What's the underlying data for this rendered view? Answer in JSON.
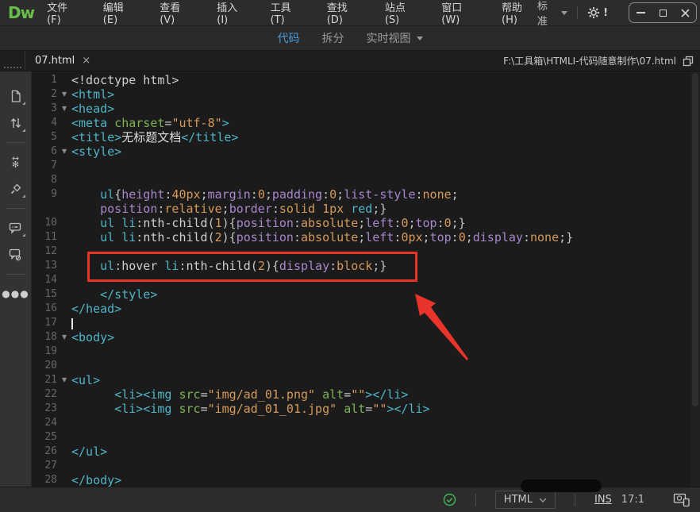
{
  "colors": {
    "bg-editor": "#1b1b1b",
    "bg-bar": "#2c2c2c",
    "bg-side": "#333333",
    "tag": "#4fb5c7",
    "attr": "#7eb456",
    "val": "#d59a5b",
    "prop": "#a887cd",
    "pun": "#c4c4c4",
    "pln": "#cfcfcf",
    "txt": "#dcdcdc",
    "accent": "#4a9bd9",
    "annot": "#e8342a",
    "logo": "#6abf4b",
    "check": "#3fb950"
  },
  "titlebar": {
    "logo": "Dw",
    "menus": [
      {
        "id": "file",
        "label": "文件(F)"
      },
      {
        "id": "edit",
        "label": "编辑(E)"
      },
      {
        "id": "view",
        "label": "查看(V)"
      },
      {
        "id": "insert",
        "label": "插入(I)"
      },
      {
        "id": "tools",
        "label": "工具(T)"
      },
      {
        "id": "find",
        "label": "查找(D)"
      },
      {
        "id": "site",
        "label": "站点(S)"
      },
      {
        "id": "window",
        "label": "窗口(W)"
      },
      {
        "id": "help",
        "label": "帮助(H)"
      }
    ],
    "workspace": "标准",
    "notification": "!"
  },
  "viewbar": {
    "tabs": [
      {
        "id": "code",
        "label": "代码",
        "active": true,
        "dropdown": false
      },
      {
        "id": "split",
        "label": "拆分",
        "active": false,
        "dropdown": false
      },
      {
        "id": "live",
        "label": "实时视图",
        "active": false,
        "dropdown": true
      }
    ]
  },
  "tabbar": {
    "tab": "07.html",
    "close": "×",
    "path": "F:\\工具箱\\HTMLI-代码随意制作\\07.html"
  },
  "sidebar": {
    "icons": [
      "new-file",
      "move-lines",
      "toggle-word-wrap",
      "format-source-code",
      "apply-comment",
      "remove-comment",
      "more-options"
    ]
  },
  "statusbar": {
    "doctype": "HTML",
    "ins": "INS",
    "cursor_position": "17:1"
  },
  "editor": {
    "lines": [
      {
        "n": "1",
        "fold": false,
        "tokens": [
          [
            "pln",
            "<!doctype html>"
          ]
        ]
      },
      {
        "n": "2",
        "fold": true,
        "tokens": [
          [
            "tag",
            "<html>"
          ]
        ]
      },
      {
        "n": "3",
        "fold": true,
        "tokens": [
          [
            "tag",
            "<head>"
          ]
        ]
      },
      {
        "n": "4",
        "fold": false,
        "tokens": [
          [
            "tag",
            "<meta"
          ],
          [
            "pln",
            " "
          ],
          [
            "attr",
            "charset"
          ],
          [
            "pun",
            "="
          ],
          [
            "val",
            "\"utf-8\""
          ],
          [
            "tag",
            ">"
          ]
        ]
      },
      {
        "n": "5",
        "fold": false,
        "tokens": [
          [
            "tag",
            "<title>"
          ],
          [
            "txt",
            "无标题文档"
          ],
          [
            "tag",
            "</title>"
          ]
        ]
      },
      {
        "n": "6",
        "fold": true,
        "tokens": [
          [
            "tag",
            "<style>"
          ]
        ]
      },
      {
        "n": "7",
        "fold": false,
        "tokens": []
      },
      {
        "n": "8",
        "fold": false,
        "tokens": []
      },
      {
        "n": "9",
        "fold": false,
        "tokens": [
          [
            "pln",
            "    "
          ],
          [
            "tag",
            "ul"
          ],
          [
            "pun",
            "{"
          ],
          [
            "prop",
            "height"
          ],
          [
            "pun",
            ":"
          ],
          [
            "val",
            "40px"
          ],
          [
            "pun",
            ";"
          ],
          [
            "prop",
            "margin"
          ],
          [
            "pun",
            ":"
          ],
          [
            "val",
            "0"
          ],
          [
            "pun",
            ";"
          ],
          [
            "prop",
            "padding"
          ],
          [
            "pun",
            ":"
          ],
          [
            "val",
            "0"
          ],
          [
            "pun",
            ";"
          ],
          [
            "prop",
            "list-style"
          ],
          [
            "pun",
            ":"
          ],
          [
            "val",
            "none"
          ],
          [
            "pun",
            ";"
          ]
        ]
      },
      {
        "n": "",
        "fold": false,
        "tokens": [
          [
            "pln",
            "    "
          ],
          [
            "prop",
            "position"
          ],
          [
            "pun",
            ":"
          ],
          [
            "val",
            "relative"
          ],
          [
            "pun",
            ";"
          ],
          [
            "prop",
            "border"
          ],
          [
            "pun",
            ":"
          ],
          [
            "val",
            "solid 1px "
          ],
          [
            "tag",
            "red"
          ],
          [
            "pun",
            ";}"
          ]
        ]
      },
      {
        "n": "10",
        "fold": false,
        "tokens": [
          [
            "pln",
            "    "
          ],
          [
            "tag",
            "ul li"
          ],
          [
            "pun",
            ":"
          ],
          [
            "pln",
            "nth-child"
          ],
          [
            "pun",
            "("
          ],
          [
            "val",
            "1"
          ],
          [
            "pun",
            "){"
          ],
          [
            "prop",
            "position"
          ],
          [
            "pun",
            ":"
          ],
          [
            "val",
            "absolute"
          ],
          [
            "pun",
            ";"
          ],
          [
            "prop",
            "left"
          ],
          [
            "pun",
            ":"
          ],
          [
            "val",
            "0"
          ],
          [
            "pun",
            ";"
          ],
          [
            "prop",
            "top"
          ],
          [
            "pun",
            ":"
          ],
          [
            "val",
            "0"
          ],
          [
            "pun",
            ";}"
          ]
        ]
      },
      {
        "n": "11",
        "fold": false,
        "tokens": [
          [
            "pln",
            "    "
          ],
          [
            "tag",
            "ul li"
          ],
          [
            "pun",
            ":"
          ],
          [
            "pln",
            "nth-child"
          ],
          [
            "pun",
            "("
          ],
          [
            "val",
            "2"
          ],
          [
            "pun",
            "){"
          ],
          [
            "prop",
            "position"
          ],
          [
            "pun",
            ":"
          ],
          [
            "val",
            "absolute"
          ],
          [
            "pun",
            ";"
          ],
          [
            "prop",
            "left"
          ],
          [
            "pun",
            ":"
          ],
          [
            "val",
            "0px"
          ],
          [
            "pun",
            ";"
          ],
          [
            "prop",
            "top"
          ],
          [
            "pun",
            ":"
          ],
          [
            "val",
            "0"
          ],
          [
            "pun",
            ";"
          ],
          [
            "prop",
            "display"
          ],
          [
            "pun",
            ":"
          ],
          [
            "val",
            "none"
          ],
          [
            "pun",
            ";}"
          ]
        ]
      },
      {
        "n": "12",
        "fold": false,
        "tokens": []
      },
      {
        "n": "13",
        "fold": false,
        "tokens": [
          [
            "pln",
            "    "
          ],
          [
            "tag",
            "ul"
          ],
          [
            "pun",
            ":"
          ],
          [
            "pln",
            "hover "
          ],
          [
            "tag",
            "li"
          ],
          [
            "pun",
            ":"
          ],
          [
            "pln",
            "nth-child"
          ],
          [
            "pun",
            "("
          ],
          [
            "val",
            "2"
          ],
          [
            "pun",
            "){"
          ],
          [
            "prop",
            "display"
          ],
          [
            "pun",
            ":"
          ],
          [
            "val",
            "block"
          ],
          [
            "pun",
            ";}"
          ]
        ]
      },
      {
        "n": "14",
        "fold": false,
        "tokens": []
      },
      {
        "n": "15",
        "fold": false,
        "tokens": [
          [
            "pln",
            "    "
          ],
          [
            "tag",
            "</style>"
          ]
        ]
      },
      {
        "n": "16",
        "fold": false,
        "tokens": [
          [
            "tag",
            "</head>"
          ]
        ]
      },
      {
        "n": "17",
        "fold": false,
        "tokens": [
          [
            "caret",
            ""
          ]
        ]
      },
      {
        "n": "18",
        "fold": true,
        "tokens": [
          [
            "tag",
            "<body>"
          ]
        ]
      },
      {
        "n": "19",
        "fold": false,
        "tokens": []
      },
      {
        "n": "20",
        "fold": false,
        "tokens": []
      },
      {
        "n": "21",
        "fold": true,
        "tokens": [
          [
            "tag",
            "<ul>"
          ]
        ]
      },
      {
        "n": "22",
        "fold": false,
        "tokens": [
          [
            "pln",
            "      "
          ],
          [
            "tag",
            "<li><img"
          ],
          [
            "pln",
            " "
          ],
          [
            "attr",
            "src"
          ],
          [
            "pun",
            "="
          ],
          [
            "val",
            "\"img/ad_01.png\""
          ],
          [
            "pln",
            " "
          ],
          [
            "attr",
            "alt"
          ],
          [
            "pun",
            "="
          ],
          [
            "val",
            "\"\""
          ],
          [
            "tag",
            "></li>"
          ]
        ]
      },
      {
        "n": "23",
        "fold": false,
        "tokens": [
          [
            "pln",
            "      "
          ],
          [
            "tag",
            "<li><img"
          ],
          [
            "pln",
            " "
          ],
          [
            "attr",
            "src"
          ],
          [
            "pun",
            "="
          ],
          [
            "val",
            "\"img/ad_01_01.jpg\""
          ],
          [
            "pln",
            " "
          ],
          [
            "attr",
            "alt"
          ],
          [
            "pun",
            "="
          ],
          [
            "val",
            "\"\""
          ],
          [
            "tag",
            "></li>"
          ]
        ]
      },
      {
        "n": "24",
        "fold": false,
        "tokens": []
      },
      {
        "n": "25",
        "fold": false,
        "tokens": []
      },
      {
        "n": "26",
        "fold": false,
        "tokens": [
          [
            "tag",
            "</ul>"
          ]
        ]
      },
      {
        "n": "27",
        "fold": false,
        "tokens": []
      },
      {
        "n": "28",
        "fold": false,
        "tokens": [
          [
            "tag",
            "</body>"
          ]
        ]
      }
    ]
  }
}
